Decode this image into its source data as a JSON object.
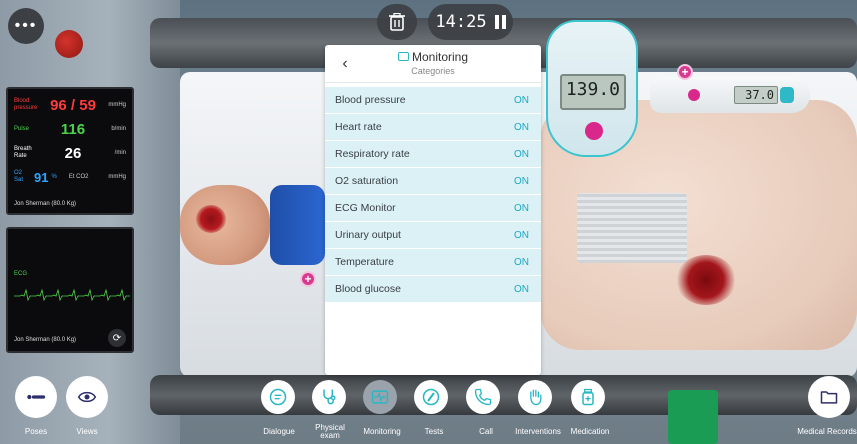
{
  "top": {
    "menu_label": "•••",
    "timer": "14:25"
  },
  "vitals": {
    "rows": [
      {
        "label": "Blood pressure",
        "value": "96 / 59",
        "unit": "mmHg",
        "color": "#ff3b3b"
      },
      {
        "label": "Pulse",
        "value": "116",
        "unit": "b/min",
        "color": "#4bd34b"
      },
      {
        "label": "Breath Rate",
        "value": "26",
        "unit": "/min",
        "color": "#ffffff"
      }
    ],
    "o2": {
      "label": "O2 Sat",
      "value": "91",
      "pct": "%",
      "co2_label": "Et CO2",
      "unit": "mmHg"
    },
    "patient": "Jon Sherman (80.0 Kg)"
  },
  "ecg": {
    "label": "ECG",
    "patient": "Jon Sherman (80.0 Kg)"
  },
  "panel": {
    "title": "Monitoring",
    "subtitle": "Categories",
    "rows": [
      {
        "name": "Blood pressure",
        "state": "ON"
      },
      {
        "name": "Heart rate",
        "state": "ON"
      },
      {
        "name": "Respiratory rate",
        "state": "ON"
      },
      {
        "name": "O2 saturation",
        "state": "ON"
      },
      {
        "name": "ECG Monitor",
        "state": "ON"
      },
      {
        "name": "Urinary output",
        "state": "ON"
      },
      {
        "name": "Temperature",
        "state": "ON"
      },
      {
        "name": "Blood glucose",
        "state": "ON"
      }
    ]
  },
  "devices": {
    "glucometer_value": "139.0",
    "thermometer_value": "37.0"
  },
  "toolbar": {
    "poses": "Poses",
    "views": "Views",
    "dialogue": "Dialogue",
    "physical_line1": "Physical",
    "physical_line2": "exam",
    "monitoring": "Monitoring",
    "tests": "Tests",
    "call": "Call",
    "interventions": "Interventions",
    "medication": "Medication",
    "medical_records": "Medical Records"
  },
  "colors": {
    "accent": "#28b7c4",
    "row_bg": "#dbf1f6",
    "plus": "#d93a8e"
  }
}
